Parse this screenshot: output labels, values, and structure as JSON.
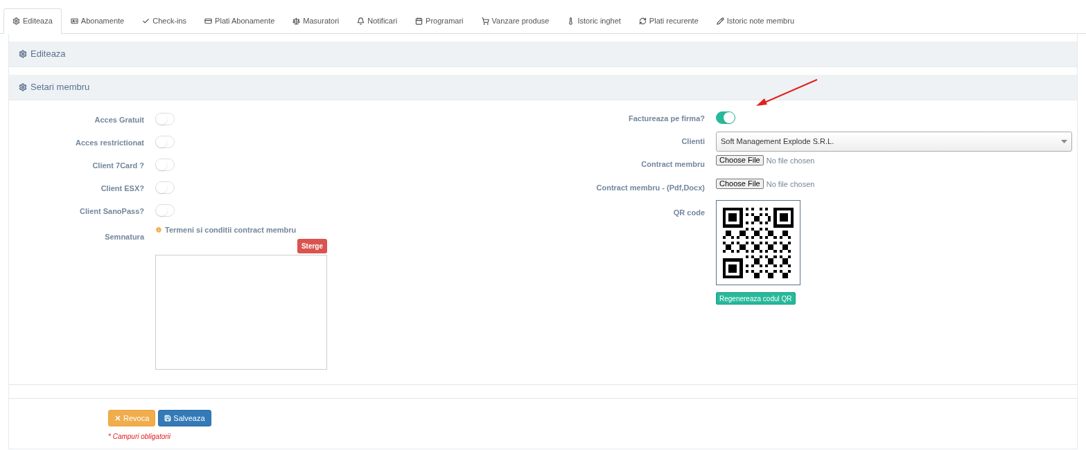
{
  "tabs": [
    {
      "label": "Editeaza",
      "selected": true
    },
    {
      "label": "Abonamente",
      "selected": false
    },
    {
      "label": "Check-ins",
      "selected": false
    },
    {
      "label": "Plati Abonamente",
      "selected": false
    },
    {
      "label": "Masuratori",
      "selected": false
    },
    {
      "label": "Notificari",
      "selected": false
    },
    {
      "label": "Programari",
      "selected": false
    },
    {
      "label": "Vanzare produse",
      "selected": false
    },
    {
      "label": "Istoric inghet",
      "selected": false
    },
    {
      "label": "Plati recurente",
      "selected": false
    },
    {
      "label": "Istoric note membru",
      "selected": false
    }
  ],
  "panels": [
    "Editeaza",
    "Setari membru"
  ],
  "left_fields": [
    {
      "label": "Acces Gratuit",
      "on": false
    },
    {
      "label": "Acces restrictionat",
      "on": false
    },
    {
      "label": "Client 7Card ?",
      "on": false
    },
    {
      "label": "Client ESX?",
      "on": false
    },
    {
      "label": "Client SanoPass?",
      "on": false
    }
  ],
  "signature": {
    "label": "Semnatura",
    "info": "Termeni si conditii contract membru",
    "clear_button": "Sterge"
  },
  "right": {
    "invoice_toggle": {
      "label": "Factureaza pe firma?",
      "on": true
    },
    "clients": {
      "label": "Clienti",
      "value": "Soft Management Explode S.R.L."
    },
    "files": [
      {
        "label": "Contract membru",
        "button": "Choose File",
        "status": "No file chosen"
      },
      {
        "label": "Contract membru - (Pdf,Docx)",
        "button": "Choose File",
        "status": "No file chosen"
      }
    ],
    "qr": {
      "label": "QR code",
      "button": "Regenereaza codul QR"
    }
  },
  "footer": {
    "cancel": "Revoca",
    "save": "Salveaza",
    "note": "* Campuri obligatorii"
  }
}
